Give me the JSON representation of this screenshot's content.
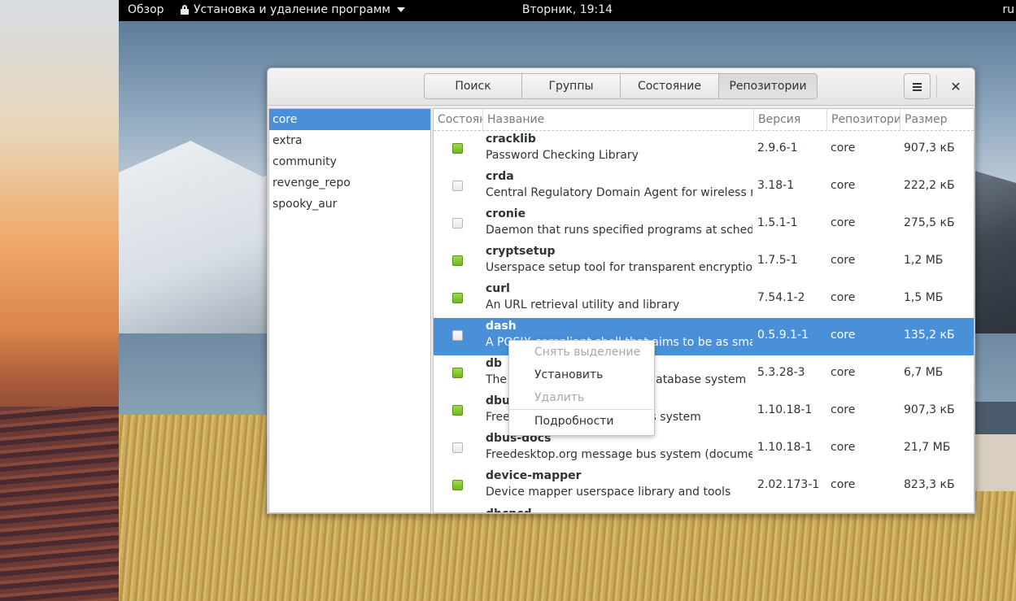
{
  "topbar": {
    "activities": "Обзор",
    "app_menu": "Установка и удаление программ",
    "clock": "Вторник, 19:14",
    "language": "ru"
  },
  "window": {
    "tabs": [
      {
        "label": "Поиск",
        "active": false
      },
      {
        "label": "Группы",
        "active": false
      },
      {
        "label": "Состояние",
        "active": false
      },
      {
        "label": "Репозитории",
        "active": true
      }
    ],
    "close_glyph": "✕"
  },
  "repositories": [
    {
      "label": "core",
      "selected": true
    },
    {
      "label": "extra",
      "selected": false
    },
    {
      "label": "community",
      "selected": false
    },
    {
      "label": "revenge_repo",
      "selected": false
    },
    {
      "label": "spooky_aur",
      "selected": false
    }
  ],
  "table": {
    "columns": [
      "Состояние",
      "Название",
      "Версия",
      "Репозитории",
      "Размер"
    ],
    "rows": [
      {
        "installed": true,
        "name": "cracklib",
        "desc": "Password Checking Library",
        "version": "2.9.6-1",
        "repo": "core",
        "size": "907,3 кБ"
      },
      {
        "installed": false,
        "name": "crda",
        "desc": "Central Regulatory Domain Agent for wireless netw",
        "version": "3.18-1",
        "repo": "core",
        "size": "222,2 кБ"
      },
      {
        "installed": false,
        "name": "cronie",
        "desc": "Daemon that runs specified programs at scheduled",
        "version": "1.5.1-1",
        "repo": "core",
        "size": "275,5 кБ"
      },
      {
        "installed": true,
        "name": "cryptsetup",
        "desc": "Userspace setup tool for transparent encryption of",
        "version": "1.7.5-1",
        "repo": "core",
        "size": "1,2 МБ"
      },
      {
        "installed": true,
        "name": "curl",
        "desc": "An URL retrieval utility and library",
        "version": "7.54.1-2",
        "repo": "core",
        "size": "1,5 МБ"
      },
      {
        "installed": false,
        "name": "dash",
        "desc": "A POSIX compliant shell that aims to be as small as",
        "version": "0.5.9.1-1",
        "repo": "core",
        "size": "135,2 кБ",
        "selected": true
      },
      {
        "installed": true,
        "name": "db",
        "desc": "The Berkeley DB embedded database system",
        "version": "5.3.28-3",
        "repo": "core",
        "size": "6,7 МБ"
      },
      {
        "installed": true,
        "name": "dbus",
        "desc": "Freedesktop.org message bus system",
        "version": "1.10.18-1",
        "repo": "core",
        "size": "907,3 кБ"
      },
      {
        "installed": false,
        "name": "dbus-docs",
        "desc": "Freedesktop.org message bus system (documentat",
        "version": "1.10.18-1",
        "repo": "core",
        "size": "21,7 МБ"
      },
      {
        "installed": true,
        "name": "device-mapper",
        "desc": "Device mapper userspace library and tools",
        "version": "2.02.173-1",
        "repo": "core",
        "size": "823,3 кБ"
      }
    ],
    "partial_row_name": "dhcpcd"
  },
  "context_menu": {
    "items": [
      {
        "label": "Снять выделение",
        "enabled": false
      },
      {
        "label": "Установить",
        "enabled": true
      },
      {
        "label": "Удалить",
        "enabled": false
      },
      {
        "label": "Подробности",
        "enabled": true
      }
    ]
  },
  "colors": {
    "selection": "#4a90d9",
    "installed_check": "#7cc22e",
    "topbar": "#000000"
  }
}
